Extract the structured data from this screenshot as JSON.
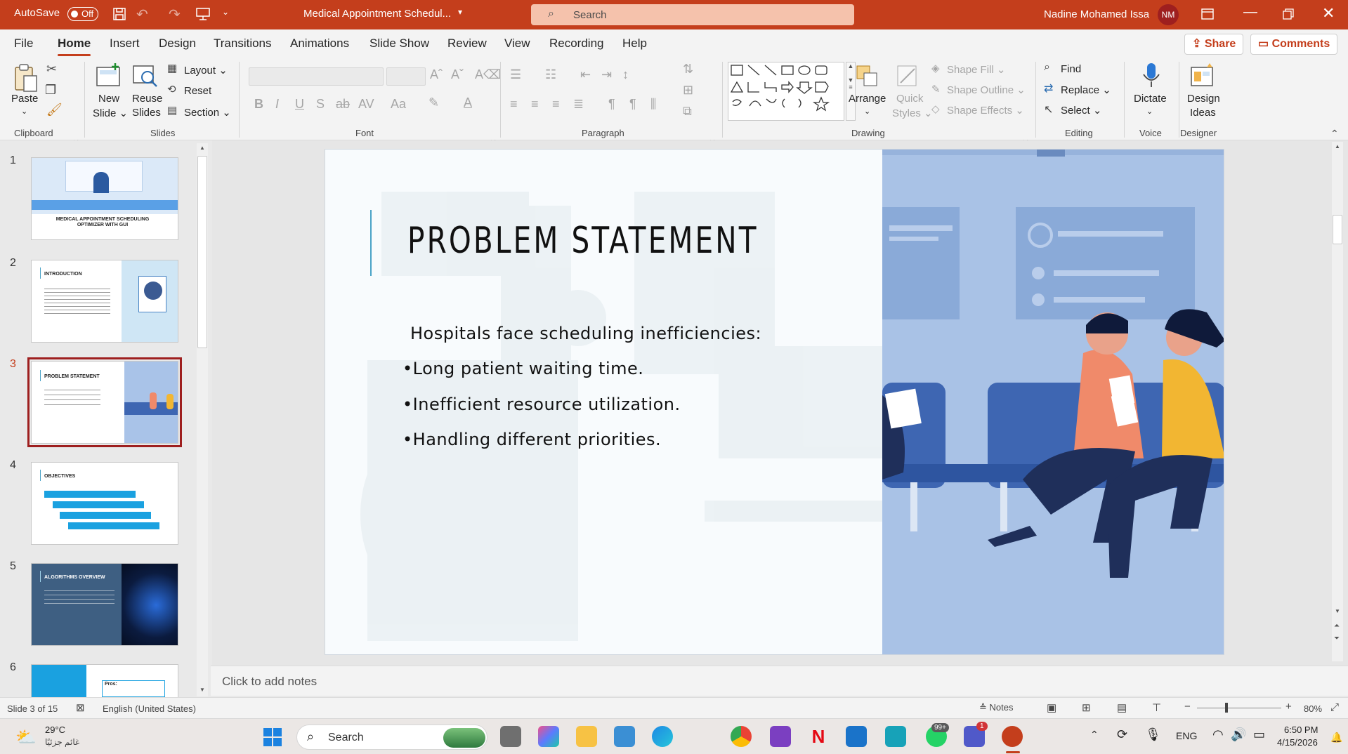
{
  "titlebar": {
    "autosave_label": "AutoSave",
    "autosave_state": "Off",
    "doc_title": "Medical Appointment Schedul...",
    "search_placeholder": "Search",
    "user_name": "Nadine Mohamed Issa",
    "user_initials": "NM"
  },
  "menu": {
    "tabs": [
      "File",
      "Home",
      "Insert",
      "Design",
      "Transitions",
      "Animations",
      "Slide Show",
      "Review",
      "View",
      "Recording",
      "Help"
    ],
    "active": "Home",
    "share": "Share",
    "comments": "Comments"
  },
  "ribbon": {
    "clipboard": {
      "paste": "Paste",
      "label": "Clipboard"
    },
    "slides": {
      "new_slide_1": "New",
      "new_slide_2": "Slide",
      "reuse_1": "Reuse",
      "reuse_2": "Slides",
      "layout": "Layout",
      "reset": "Reset",
      "section": "Section",
      "label": "Slides"
    },
    "font": {
      "label": "Font",
      "bold": "B",
      "italic": "I",
      "underline": "U",
      "shadow": "S",
      "strike": "ab",
      "case": "Aa"
    },
    "paragraph": {
      "label": "Paragraph"
    },
    "drawing": {
      "arrange": "Arrange",
      "quick_1": "Quick",
      "quick_2": "Styles",
      "shape_fill": "Shape Fill",
      "shape_outline": "Shape Outline",
      "shape_effects": "Shape Effects",
      "label": "Drawing"
    },
    "editing": {
      "find": "Find",
      "replace": "Replace",
      "select": "Select",
      "label": "Editing"
    },
    "voice": {
      "dictate": "Dictate",
      "label": "Voice"
    },
    "designer": {
      "ideas_1": "Design",
      "ideas_2": "Ideas",
      "label": "Designer"
    }
  },
  "thumbnails": [
    {
      "num": "1",
      "title": "MEDICAL APPOINTMENT SCHEDULING OPTIMIZER WITH GUI"
    },
    {
      "num": "2",
      "title": "INTRODUCTION"
    },
    {
      "num": "3",
      "title": "PROBLEM STATEMENT"
    },
    {
      "num": "4",
      "title": "OBJECTIVES"
    },
    {
      "num": "5",
      "title": "ALGORITHMS OVERVIEW"
    },
    {
      "num": "6",
      "title": "Pros:"
    }
  ],
  "slide": {
    "title": "PROBLEM STATEMENT",
    "intro": "Hospitals face scheduling inefficiencies:",
    "bullets": [
      "•Long patient waiting time.",
      "•Inefficient resource utilization.",
      "•Handling different priorities."
    ]
  },
  "notes": {
    "placeholder": "Click to add notes"
  },
  "status": {
    "slide_of": "Slide 3 of 15",
    "language": "English (United States)",
    "notes": "Notes",
    "zoom": "80%"
  },
  "taskbar": {
    "temp": "29°C",
    "weather_text": "غائم جزئيًا",
    "search": "Search",
    "whatsapp_badge": "99+",
    "teams_badge": "1",
    "lang": "ENG",
    "time": "6:50 PM",
    "date": "4/15/2026"
  }
}
